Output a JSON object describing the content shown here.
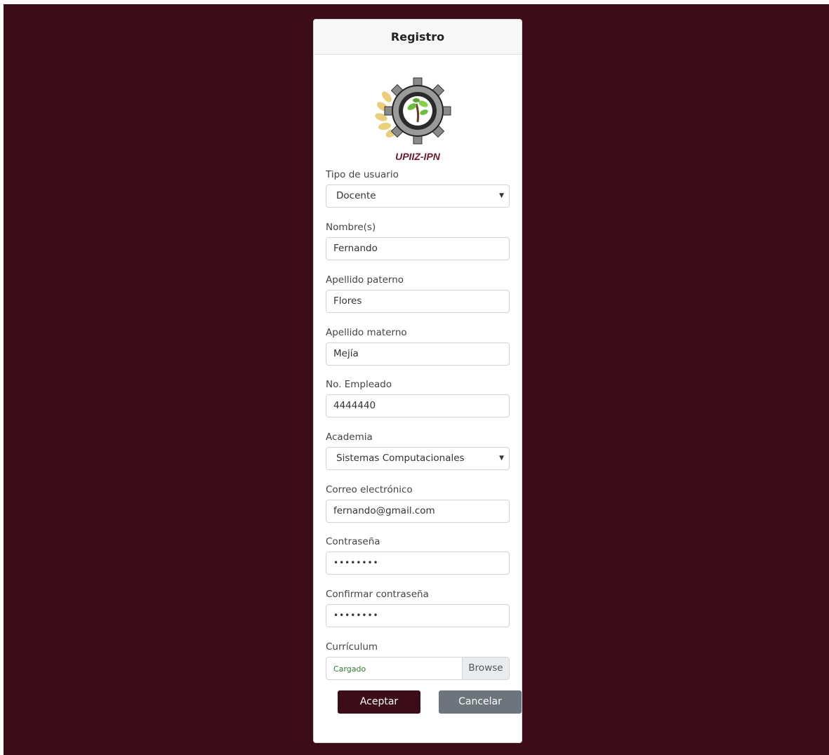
{
  "card": {
    "title": "Registro"
  },
  "logo": {
    "text": "UPIIZ-IPN"
  },
  "form": {
    "tipo_usuario": {
      "label": "Tipo de usuario",
      "value": "Docente"
    },
    "nombre": {
      "label": "Nombre(s)",
      "value": "Fernando"
    },
    "apellido_paterno": {
      "label": "Apellido paterno",
      "value": "Flores"
    },
    "apellido_materno": {
      "label": "Apellido materno",
      "value": "Mejía"
    },
    "no_empleado": {
      "label": "No. Empleado",
      "value": "4444440"
    },
    "academia": {
      "label": "Academia",
      "value": "Sistemas Computacionales"
    },
    "correo": {
      "label": "Correo electrónico",
      "value": "fernando@gmail.com"
    },
    "contrasena": {
      "label": "Contraseña",
      "value": "••••••••"
    },
    "confirmar": {
      "label": "Confirmar contraseña",
      "value": "••••••••"
    },
    "curriculum": {
      "label": "Currículum",
      "status": "Cargado",
      "browse": "Browse"
    }
  },
  "buttons": {
    "accept": "Aceptar",
    "cancel": "Cancelar"
  },
  "colors": {
    "background": "#3c0d19",
    "accept": "#3c0d19",
    "cancel": "#6c757d"
  },
  "icons": {
    "select_caret": "caret-down-icon",
    "logo": "gear-leaf-logo"
  }
}
